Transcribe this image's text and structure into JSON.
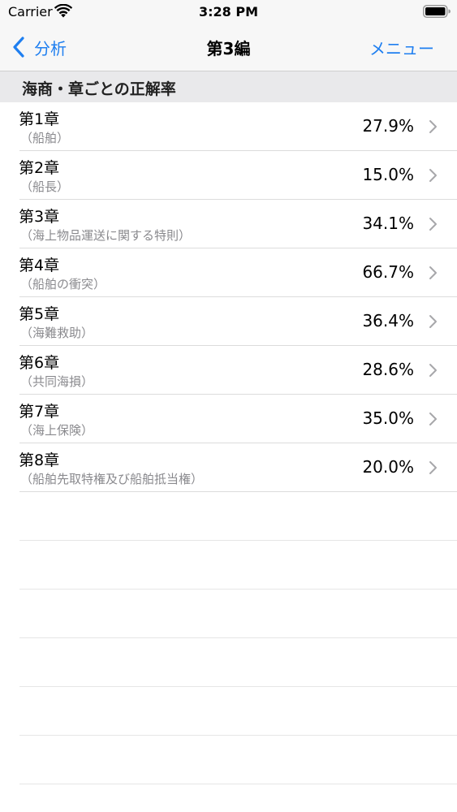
{
  "status_bar": {
    "carrier": "Carrier",
    "time": "3:28 PM"
  },
  "nav": {
    "back_label": "分析",
    "title": "第3編",
    "menu_label": "メニュー",
    "accent_color": "#1f7ff0"
  },
  "section": {
    "title": "海商・章ごとの正解率"
  },
  "rows": [
    {
      "title": "第1章",
      "subtitle": "（船舶）",
      "value": "27.9%"
    },
    {
      "title": "第2章",
      "subtitle": "（船長）",
      "value": "15.0%"
    },
    {
      "title": "第3章",
      "subtitle": "（海上物品運送に関する特則）",
      "value": "34.1%"
    },
    {
      "title": "第4章",
      "subtitle": "（船舶の衝突）",
      "value": "66.7%"
    },
    {
      "title": "第5章",
      "subtitle": "（海難救助）",
      "value": "36.4%"
    },
    {
      "title": "第6章",
      "subtitle": "（共同海損）",
      "value": "28.6%"
    },
    {
      "title": "第7章",
      "subtitle": "（海上保険）",
      "value": "35.0%"
    },
    {
      "title": "第8章",
      "subtitle": "（船舶先取特権及び船舶抵当権）",
      "value": "20.0%"
    }
  ]
}
